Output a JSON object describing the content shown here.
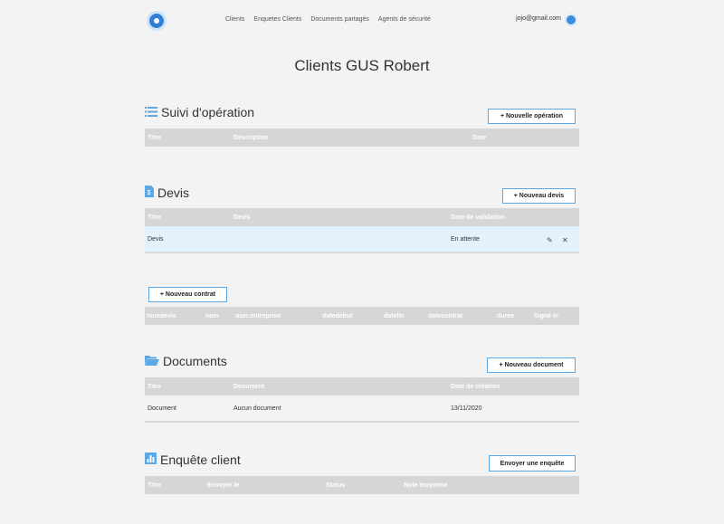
{
  "nav": {
    "links": [
      "Clients",
      "Enquetes Clients",
      "Documents partagés",
      "Agents de sécurité"
    ],
    "user_email": "jojo@gmail.com"
  },
  "page_title": "Clients GUS Robert",
  "suivi": {
    "title": "Suivi d'opération",
    "button": "+ Nouvelle opération",
    "columns": [
      "Titre",
      "Description",
      "Date"
    ]
  },
  "devis": {
    "title": "Devis",
    "button": "+ Nouveau devis",
    "columns": [
      "Titre",
      "Devis",
      "Date de validation"
    ],
    "rows": [
      {
        "titre": "Devis",
        "devis": "",
        "date": "En attente"
      }
    ]
  },
  "contrat": {
    "button": "+ Nouveau contrat",
    "columns": [
      "numdevis",
      "nom",
      "user.entreprise",
      "datedebut",
      "datefin",
      "datecontrat",
      "duree",
      "Signé le"
    ]
  },
  "documents": {
    "title": "Documents",
    "button": "+ Nouveau document",
    "columns": [
      "Titre",
      "Document",
      "Date de création"
    ],
    "rows": [
      {
        "titre": "Document",
        "document": "Aucun document",
        "date": "13/11/2020"
      }
    ]
  },
  "enquete": {
    "title": "Enquête client",
    "button": "Envoyer une enquête",
    "columns": [
      "Titre",
      "Envoyer le",
      "Status",
      "Note moyenne"
    ]
  },
  "colors": {
    "accent": "#5aa9e6",
    "header_bg": "#d6d6d6",
    "row_highlight": "#e2f1fb"
  }
}
